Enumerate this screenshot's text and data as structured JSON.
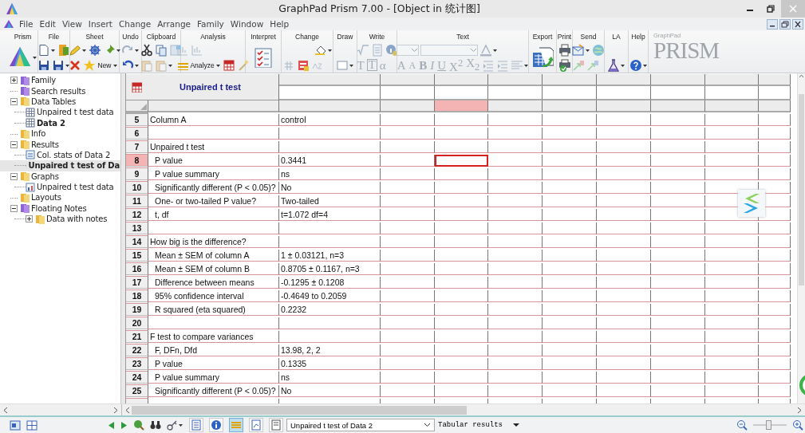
{
  "window": {
    "title": "GraphPad Prism 7.00 - [Object in 统计图]"
  },
  "menu": [
    "File",
    "Edit",
    "View",
    "Insert",
    "Change",
    "Arrange",
    "Family",
    "Window",
    "Help"
  ],
  "ribbon": [
    {
      "label": "Prism"
    },
    {
      "label": "File"
    },
    {
      "label": "Sheet",
      "buttons": [
        "New"
      ]
    },
    {
      "label": "Undo"
    },
    {
      "label": "Clipboard"
    },
    {
      "label": "Analysis",
      "buttons": [
        "Analyze"
      ]
    },
    {
      "label": "Interpret"
    },
    {
      "label": "Change"
    },
    {
      "label": "Draw"
    },
    {
      "label": "Write",
      "glyphs": [
        "T",
        "T",
        "α"
      ]
    },
    {
      "label": "Text",
      "glyphs": [
        "A",
        "A",
        "B",
        "I",
        "U",
        "X$^{2}$",
        "X$_{2}$"
      ]
    },
    {
      "label": "Export"
    },
    {
      "label": "Print"
    },
    {
      "label": "Send"
    },
    {
      "label": "LA"
    },
    {
      "label": "Help"
    }
  ],
  "logo": {
    "maker": "GraphPad",
    "name": "PRISM"
  },
  "navigator": [
    {
      "name": "Family",
      "kind": "family",
      "expanded": false,
      "bold": false,
      "selected": false
    },
    {
      "name": "Search results",
      "kind": "family",
      "bold": false,
      "selected": false
    },
    {
      "name": "Data Tables",
      "kind": "folder",
      "expanded": true,
      "bold": false,
      "selected": false,
      "children": [
        {
          "name": "Unpaired t test data",
          "kind": "table",
          "bold": false,
          "selected": false
        },
        {
          "name": "Data 2",
          "kind": "table",
          "bold": true,
          "selected": false
        }
      ]
    },
    {
      "name": "Info",
      "kind": "folder",
      "bold": false,
      "selected": false
    },
    {
      "name": "Results",
      "kind": "folder",
      "expanded": true,
      "bold": false,
      "selected": false,
      "children": [
        {
          "name": "Col. stats of Data 2",
          "kind": "stats",
          "bold": false,
          "selected": false
        },
        {
          "name": "Unpaired t test of Da",
          "kind": "result",
          "bold": true,
          "selected": true
        }
      ]
    },
    {
      "name": "Graphs",
      "kind": "folder",
      "expanded": true,
      "bold": false,
      "selected": false,
      "children": [
        {
          "name": "Unpaired t test data",
          "kind": "graph",
          "bold": false,
          "selected": false
        }
      ]
    },
    {
      "name": "Layouts",
      "kind": "folder",
      "bold": false,
      "selected": false
    },
    {
      "name": "Floating Notes",
      "kind": "family",
      "expanded": true,
      "bold": false,
      "selected": false,
      "children": [
        {
          "name": "Data with notes",
          "kind": "folder",
          "expanded": false,
          "bold": false,
          "selected": false
        }
      ]
    }
  ],
  "sheet": {
    "title": "Unpaired t test",
    "columns": [
      {
        "selected": false
      },
      {
        "selected": false
      },
      {
        "selected": false
      },
      {
        "selected": true
      },
      {
        "selected": false
      },
      {
        "selected": false
      },
      {
        "selected": false
      },
      {
        "selected": false
      },
      {
        "selected": false
      },
      {
        "selected": false
      }
    ],
    "rows": [
      {
        "number": "5",
        "label": "Column A",
        "value": "control",
        "selected": false
      },
      {
        "number": "6",
        "selected": false
      },
      {
        "number": "7",
        "label": "Unpaired t test",
        "selected": false,
        "children": [
          {
            "number": "8",
            "label": "P value",
            "value": "0.3441",
            "selected": true
          },
          {
            "number": "9",
            "label": "P value summary",
            "value": "ns",
            "selected": false
          },
          {
            "number": "10",
            "label": "Significantly different (P < 0.05)?",
            "value": "No",
            "selected": false
          },
          {
            "number": "11",
            "label": "One- or two-tailed P value?",
            "value": "Two-tailed",
            "selected": false
          },
          {
            "number": "12",
            "label": "t, df",
            "value": "t=1.072 df=4",
            "selected": false
          }
        ]
      },
      {
        "number": "13",
        "selected": false
      },
      {
        "number": "14",
        "label": "How big is the difference?",
        "selected": false,
        "children": [
          {
            "number": "15",
            "label": "Mean ± SEM of column A",
            "value": "1 ± 0.03121, n=3",
            "selected": false
          },
          {
            "number": "16",
            "label": "Mean ± SEM of column B",
            "value": "0.8705 ± 0.1167, n=3",
            "selected": false
          },
          {
            "number": "17",
            "label": "Difference between means",
            "value": "-0.1295 ± 0.1208",
            "selected": false
          },
          {
            "number": "18",
            "label": "95% confidence interval",
            "value": "-0.4649 to 0.2059",
            "selected": false
          },
          {
            "number": "19",
            "label": "R squared (eta squared)",
            "value": "0.2232",
            "selected": false
          }
        ]
      },
      {
        "number": "20",
        "selected": false
      },
      {
        "number": "21",
        "label": "F test to compare variances",
        "selected": false,
        "children": [
          {
            "number": "22",
            "label": "F, DFn, Dfd",
            "value": "13.98, 2, 2",
            "selected": false
          },
          {
            "number": "23",
            "label": "P value",
            "value": "0.1335",
            "selected": false
          },
          {
            "number": "24",
            "label": "P value summary",
            "value": "ns",
            "selected": false
          },
          {
            "number": "25",
            "label": "Significantly different (P < 0.05)?",
            "value": "No",
            "selected": false
          }
        ]
      }
    ]
  },
  "status_bar": {
    "view_modes": [
      {
        "selected": false
      },
      {
        "selected": false
      },
      {
        "selected": true
      },
      {
        "selected": false
      },
      {
        "selected": false
      }
    ],
    "sheet_picker": "Unpaired t test of Data 2",
    "view_picker": "Tabular results",
    "zoom": {
      "level": 0.45
    }
  }
}
